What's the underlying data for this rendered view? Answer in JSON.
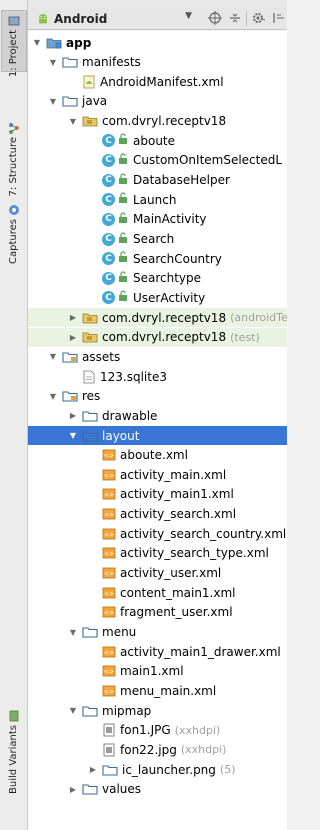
{
  "header": {
    "view_mode": "Android",
    "caret": "▼",
    "icons": [
      "sync-icon",
      "collapse-icon",
      "settings-icon",
      "hide-icon"
    ]
  },
  "side_tabs": [
    {
      "label": "1: Project",
      "icon": "project-icon",
      "active": true
    },
    {
      "label": "7: Structure",
      "icon": "structure-icon",
      "active": false
    },
    {
      "label": "Captures",
      "icon": "captures-icon",
      "active": false
    },
    {
      "label": "Build Variants",
      "icon": "build-variants-icon",
      "active": false
    }
  ],
  "tree": [
    {
      "level": 0,
      "arrow": "▼",
      "icon": "module-folder-icon",
      "label": "app",
      "bold": true
    },
    {
      "level": 1,
      "arrow": "▼",
      "icon": "folder-icon",
      "label": "manifests"
    },
    {
      "level": 2,
      "arrow": "",
      "icon": "manifest-file-icon",
      "label": "AndroidManifest.xml"
    },
    {
      "level": 1,
      "arrow": "▼",
      "icon": "folder-icon",
      "label": "java"
    },
    {
      "level": 2,
      "arrow": "▼",
      "icon": "package-icon",
      "label": "com.dvryl.receptv18"
    },
    {
      "level": 3,
      "arrow": "",
      "icon": "class-icon",
      "label": "aboute"
    },
    {
      "level": 3,
      "arrow": "",
      "icon": "class-icon",
      "label": "CustomOnItemSelectedL"
    },
    {
      "level": 3,
      "arrow": "",
      "icon": "class-icon",
      "label": "DatabaseHelper"
    },
    {
      "level": 3,
      "arrow": "",
      "icon": "class-icon",
      "label": "Launch"
    },
    {
      "level": 3,
      "arrow": "",
      "icon": "class-icon",
      "label": "MainActivity"
    },
    {
      "level": 3,
      "arrow": "",
      "icon": "class-icon",
      "label": "Search"
    },
    {
      "level": 3,
      "arrow": "",
      "icon": "class-icon",
      "label": "SearchCountry"
    },
    {
      "level": 3,
      "arrow": "",
      "icon": "class-icon",
      "label": "Searchtype"
    },
    {
      "level": 3,
      "arrow": "",
      "icon": "class-icon",
      "label": "UserActivity"
    },
    {
      "level": 2,
      "arrow": "▶",
      "icon": "package-icon",
      "label": "com.dvryl.receptv18",
      "hint": "(androidTe",
      "green": true
    },
    {
      "level": 2,
      "arrow": "▶",
      "icon": "package-icon",
      "label": "com.dvryl.receptv18",
      "hint": "(test)",
      "green": true
    },
    {
      "level": 1,
      "arrow": "▼",
      "icon": "assets-folder-icon",
      "label": "assets"
    },
    {
      "level": 2,
      "arrow": "",
      "icon": "file-icon",
      "label": "123.sqlite3"
    },
    {
      "level": 1,
      "arrow": "▼",
      "icon": "res-folder-icon",
      "label": "res"
    },
    {
      "level": 2,
      "arrow": "▶",
      "icon": "folder-icon",
      "label": "drawable"
    },
    {
      "level": 2,
      "arrow": "▼",
      "icon": "folder-icon",
      "label": "layout",
      "selected": true
    },
    {
      "level": 3,
      "arrow": "",
      "icon": "xml-file-icon",
      "label": "aboute.xml"
    },
    {
      "level": 3,
      "arrow": "",
      "icon": "xml-file-icon",
      "label": "activity_main.xml"
    },
    {
      "level": 3,
      "arrow": "",
      "icon": "xml-file-icon",
      "label": "activity_main1.xml"
    },
    {
      "level": 3,
      "arrow": "",
      "icon": "xml-file-icon",
      "label": "activity_search.xml"
    },
    {
      "level": 3,
      "arrow": "",
      "icon": "xml-file-icon",
      "label": "activity_search_country.xml"
    },
    {
      "level": 3,
      "arrow": "",
      "icon": "xml-file-icon",
      "label": "activity_search_type.xml"
    },
    {
      "level": 3,
      "arrow": "",
      "icon": "xml-file-icon",
      "label": "activity_user.xml"
    },
    {
      "level": 3,
      "arrow": "",
      "icon": "xml-file-icon",
      "label": "content_main1.xml"
    },
    {
      "level": 3,
      "arrow": "",
      "icon": "xml-file-icon",
      "label": "fragment_user.xml"
    },
    {
      "level": 2,
      "arrow": "▼",
      "icon": "folder-icon",
      "label": "menu"
    },
    {
      "level": 3,
      "arrow": "",
      "icon": "xml-file-icon",
      "label": "activity_main1_drawer.xml"
    },
    {
      "level": 3,
      "arrow": "",
      "icon": "xml-file-icon",
      "label": "main1.xml"
    },
    {
      "level": 3,
      "arrow": "",
      "icon": "xml-file-icon",
      "label": "menu_main.xml"
    },
    {
      "level": 2,
      "arrow": "▼",
      "icon": "folder-icon",
      "label": "mipmap"
    },
    {
      "level": 3,
      "arrow": "",
      "icon": "image-file-icon",
      "label": "fon1.JPG",
      "hint": "(xxhdpi)"
    },
    {
      "level": 3,
      "arrow": "",
      "icon": "image-file-icon",
      "label": "fon22.jpg",
      "hint": "(xxhdpi)"
    },
    {
      "level": 3,
      "arrow": "▶",
      "icon": "folder-icon",
      "label": "ic_launcher.png",
      "hint": "(5)"
    },
    {
      "level": 2,
      "arrow": "▶",
      "icon": "folder-icon",
      "label": "values"
    }
  ],
  "colors": {
    "selection": "#3975d6",
    "test_package_bg": "#eaf2e1",
    "class_badge": "#43a7d8",
    "folder": "#6fa0c7"
  }
}
